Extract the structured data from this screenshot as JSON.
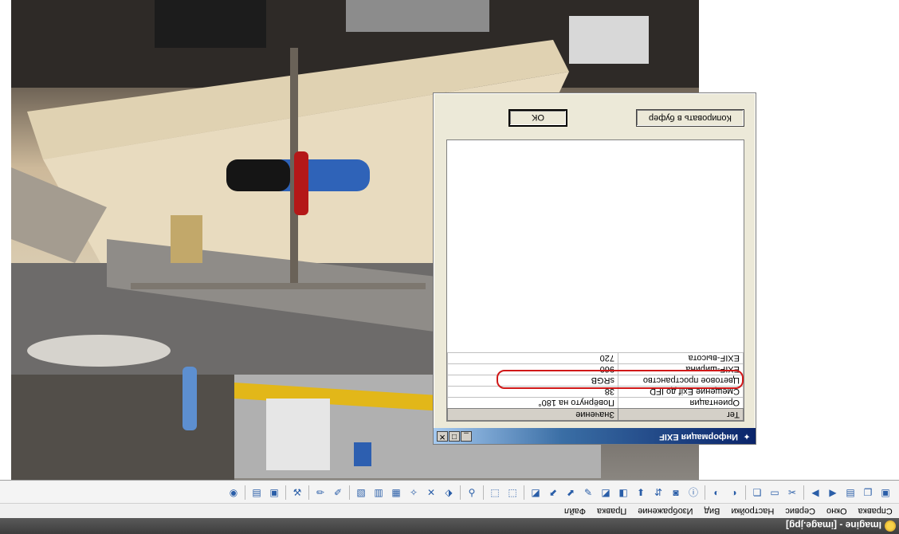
{
  "window": {
    "title": "Imagine - [image.jpg]"
  },
  "menubar": {
    "items": [
      "Файл",
      "Правка",
      "Изображение",
      "Вид",
      "Настройки",
      "Сервис",
      "Окно",
      "Справка"
    ]
  },
  "toolbar": {
    "icons": [
      "image-icon",
      "copy-icon",
      "paste-icon",
      "undo-icon",
      "redo-icon",
      "tools-icon",
      "folder-icon",
      "info-icon",
      "crop-icon",
      "up-icon",
      "down-icon",
      "frame-icon",
      "rotate-icon",
      "stamp-icon",
      "select-icon",
      "brush-icon",
      "eraser-icon",
      "first-icon",
      "prev-icon",
      "next-icon",
      "last-icon",
      "play-icon",
      "zoom-icon",
      "fit-icon",
      "fullscreen-icon",
      "eyedropper-icon",
      "layers-icon",
      "print-icon",
      "help-icon"
    ]
  },
  "dialog": {
    "title": "Информация EXIF",
    "columns": {
      "tag": "Тег",
      "value": "Значение"
    },
    "rows": [
      {
        "tag": "Ориентация",
        "value": "Повёрнуто на 180°"
      },
      {
        "tag": "Смещение Exif до IFD",
        "value": "38"
      },
      {
        "tag": "Цветовое пространство",
        "value": "sRGB"
      },
      {
        "tag": "EXIF-ширина",
        "value": "960"
      },
      {
        "tag": "EXIF-высота",
        "value": "720"
      }
    ],
    "buttons": {
      "copy": "Копировать в буфер",
      "ok": "OK"
    },
    "highlight_color": "#d01818"
  }
}
